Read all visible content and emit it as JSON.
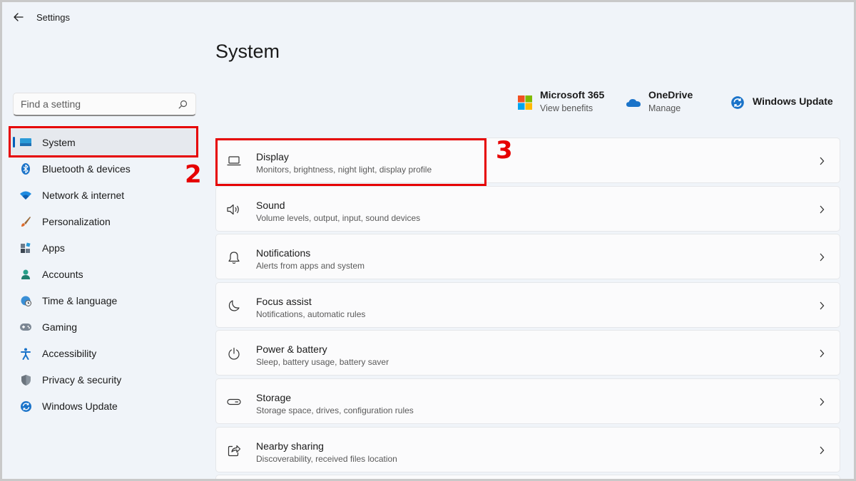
{
  "window": {
    "title": "Settings"
  },
  "search": {
    "placeholder": "Find a setting"
  },
  "sidebar": {
    "items": [
      {
        "label": "System",
        "icon": "monitor-icon",
        "active": true
      },
      {
        "label": "Bluetooth & devices",
        "icon": "bluetooth-icon"
      },
      {
        "label": "Network & internet",
        "icon": "wifi-icon"
      },
      {
        "label": "Personalization",
        "icon": "brush-icon"
      },
      {
        "label": "Apps",
        "icon": "apps-icon"
      },
      {
        "label": "Accounts",
        "icon": "account-icon"
      },
      {
        "label": "Time & language",
        "icon": "globe-clock-icon"
      },
      {
        "label": "Gaming",
        "icon": "gamepad-icon"
      },
      {
        "label": "Accessibility",
        "icon": "accessibility-icon"
      },
      {
        "label": "Privacy & security",
        "icon": "shield-icon"
      },
      {
        "label": "Windows Update",
        "icon": "update-icon"
      }
    ]
  },
  "main": {
    "title": "System",
    "quick_links": [
      {
        "title": "Microsoft 365",
        "subtitle": "View benefits",
        "icon": "microsoft-logo-icon"
      },
      {
        "title": "OneDrive",
        "subtitle": "Manage",
        "icon": "cloud-icon"
      },
      {
        "title": "Windows Update",
        "subtitle": "",
        "icon": "update-icon"
      }
    ],
    "cards": [
      {
        "title": "Display",
        "subtitle": "Monitors, brightness, night light, display profile",
        "icon": "laptop-icon"
      },
      {
        "title": "Sound",
        "subtitle": "Volume levels, output, input, sound devices",
        "icon": "speaker-icon"
      },
      {
        "title": "Notifications",
        "subtitle": "Alerts from apps and system",
        "icon": "bell-icon"
      },
      {
        "title": "Focus assist",
        "subtitle": "Notifications, automatic rules",
        "icon": "moon-icon"
      },
      {
        "title": "Power & battery",
        "subtitle": "Sleep, battery usage, battery saver",
        "icon": "power-icon"
      },
      {
        "title": "Storage",
        "subtitle": "Storage space, drives, configuration rules",
        "icon": "drive-icon"
      },
      {
        "title": "Nearby sharing",
        "subtitle": "Discoverability, received files location",
        "icon": "share-icon"
      }
    ]
  },
  "annotations": {
    "step2": "2",
    "step3": "3"
  },
  "colors": {
    "accent": "#005fb8",
    "callout": "#e60000"
  }
}
